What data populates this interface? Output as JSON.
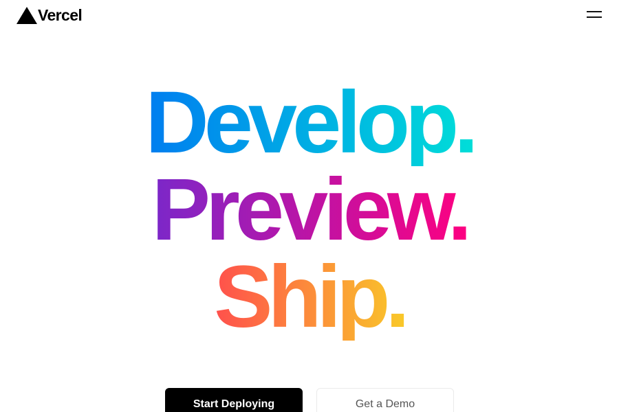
{
  "header": {
    "logo_icon": "vercel-triangle-icon",
    "logo_text": "Vercel",
    "menu_icon": "hamburger-menu-icon"
  },
  "hero": {
    "lines": [
      "Develop.",
      "Preview.",
      "Ship."
    ]
  },
  "cta": {
    "primary_label": "Start Deploying",
    "secondary_label": "Get a Demo"
  },
  "colors": {
    "develop_gradient": [
      "#007cf0",
      "#00dfd8"
    ],
    "preview_gradient": [
      "#7928ca",
      "#ff0080"
    ],
    "ship_gradient": [
      "#ff4d4d",
      "#f9cb28"
    ],
    "primary_button_bg": "#000000",
    "secondary_button_border": "#eaeaea"
  }
}
